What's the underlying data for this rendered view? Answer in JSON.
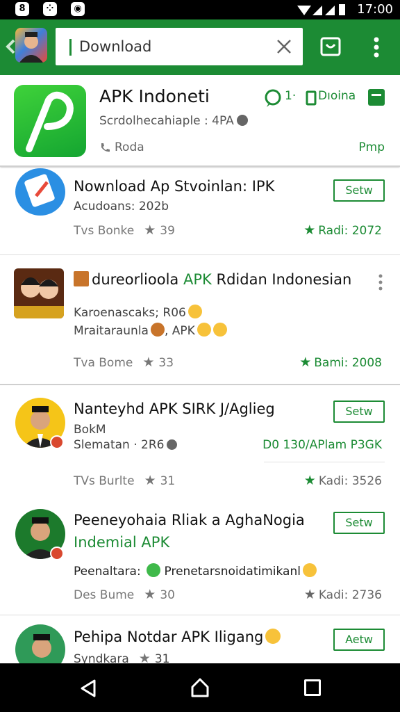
{
  "status_bar": {
    "icons": [
      "messenger-icon",
      "dice-icon",
      "camera-icon"
    ],
    "time": "17:00"
  },
  "app_bar": {
    "search_value": "Download",
    "icons": [
      "back-arrow-icon",
      "clear-icon",
      "cart-icon",
      "more-vert-icon"
    ]
  },
  "header": {
    "title": "APK Indoneti",
    "subtitle": "Scrdolhecahiaple : 4PA",
    "location": "Roda",
    "chat_count": "1·",
    "phone_label": "Dıoina",
    "link": "Pmp"
  },
  "colors": {
    "primary": "#1c8b34",
    "text": "#111111",
    "muted": "#777777"
  },
  "items": [
    {
      "title": "Nownload Ap Stvoinlan: IPK",
      "sub": "Acudoans: 202b",
      "meta_left": "Tvs Bonke",
      "meta_rating": "39",
      "right_rating": "Radi: 2072",
      "button": "Setw"
    },
    {
      "title_prefix": "dureorlioola",
      "title_green": "APK",
      "title_suffix": "Rdidan Indonesian",
      "sub1": "Karoenascaks; R06",
      "sub2_left": "Mraitaraunla",
      "sub2_right": ", APK",
      "meta_left": "Tva Bome",
      "meta_rating": "33",
      "right_rating": "Bami: 2008"
    },
    {
      "title": "Nanteyhd APK SIRK J/Aglieg",
      "sub1": "BokM",
      "sub2": "Slematan · 2R6",
      "sub2_right": "D0 130/APlam P3GK",
      "meta_left": "TVs Burlte",
      "meta_rating": "31",
      "right_rating": "Kadi: 3526",
      "button": "Setw"
    },
    {
      "title": "Peeneyohaia Rliak a AghaNogia",
      "title2": "Indemial APK",
      "sub_left": "Peenaltara:",
      "sub_right": "Prenetarsnoidatimikanl",
      "meta_left": "Des Bume",
      "meta_rating": "30",
      "right_rating": "Kadi: 2736",
      "button": "Setw"
    },
    {
      "title": "Pehipa Notdar APK Iligang",
      "sub": "Syndkara",
      "meta_rating": "31",
      "button": "Aetw"
    }
  ]
}
